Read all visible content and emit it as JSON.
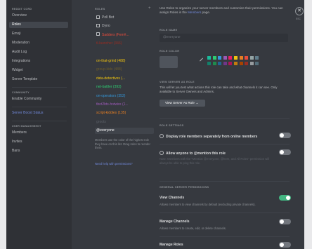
{
  "sidebar": {
    "server_header": "REDDIT CORD",
    "items": [
      "Overview",
      "Roles",
      "Emoji",
      "Moderation",
      "Audit Log",
      "Integrations",
      "Widget",
      "Server Template"
    ],
    "community_header": "COMMUNITY",
    "community_items": [
      "Enable Community"
    ],
    "boost_item": "Server Boost Status",
    "user_mgmt_header": "USER MANAGEMENT",
    "user_items": [
      "Members",
      "Invites",
      "Bans"
    ]
  },
  "roles_panel": {
    "header": "ROLES",
    "items": [
      {
        "name": "Poll Bot",
        "color": "#b9bbbe",
        "locked": true
      },
      {
        "name": "Dyno",
        "color": "#b9bbbe",
        "locked": true
      },
      {
        "name": "Sadders (Fem#...",
        "color": "#e74c3c",
        "locked": true
      },
      {
        "name": "tl-launcher (346)",
        "color": "#992d22",
        "locked": false
      },
      {
        "name": "",
        "color": "#8e3b6b",
        "locked": false
      },
      {
        "name": "on-that-grind (488)",
        "color": "#f1c40f",
        "locked": false
      },
      {
        "name": "group-kids (488)",
        "color": "#6b5a2b",
        "locked": false
      },
      {
        "name": "data-detectives (...",
        "color": "#f1c40f",
        "locked": false
      },
      {
        "name": "net-battler (393)",
        "color": "#2ecc71",
        "locked": false
      },
      {
        "name": "on-operators (352)",
        "color": "#3498db",
        "locked": false
      },
      {
        "name": "tbot2bts-hotwire (1...",
        "color": "#9b59b6",
        "locked": false
      },
      {
        "name": "script-kiddies (135)",
        "color": "#e67e22",
        "locked": false
      },
      {
        "name": "groots",
        "color": "#5c6068",
        "locked": false
      },
      {
        "name": "@everyone",
        "color": "#ffffff",
        "locked": false
      }
    ],
    "info": "Members use the color of the highest role they have on this list. Drag roles to reorder them.",
    "help_link": "Need help with permissions?"
  },
  "main": {
    "intro_text": "Use Roles to organize your server members and customize their permissions. You can assign Roles in the ",
    "intro_link": "Members",
    "intro_end": " page.",
    "role_name_label": "ROLE NAME",
    "role_name_value": "@everyone",
    "role_color_label": "ROLE COLOR",
    "colors": {
      "default": "#4f545c",
      "swatches": [
        "#1abc9c",
        "#2ecc71",
        "#3498db",
        "#9b59b6",
        "#e91e63",
        "#f1c40f",
        "#e67e22",
        "#e74c3c",
        "#95a5a6",
        "#607d8b",
        "#11806a",
        "#1f8b4c",
        "#206694",
        "#71368a",
        "#ad1457",
        "#c27c0e",
        "#a84300",
        "#992d22",
        "#979c9f",
        "#546e7a"
      ]
    },
    "view_as_label": "VIEW SERVER AS ROLE",
    "view_as_desc": "This will let you test what actions this role can take and what channels it can see. Only available to Server Owners and Admins.",
    "view_as_button": "View Server As Role →",
    "settings_label": "ROLE SETTINGS",
    "display_separately": "Display role members separately from online members",
    "allow_mention": "Allow anyone to @mention this role",
    "allow_mention_desc": "Note: Members with the \"Mention @everyone, @here, and All Roles\" permission will always be able to ping this role.",
    "permissions_label": "GENERAL SERVER PERMISSIONS",
    "permissions": [
      {
        "title": "View Channels",
        "desc": "Allows members to view channels by default (excluding private channels).",
        "on": true
      },
      {
        "title": "Manage Channels",
        "desc": "Allows members to create, edit, or delete channels.",
        "on": false
      },
      {
        "title": "Manage Roles",
        "desc": "",
        "on": false
      }
    ],
    "close_label": "✕",
    "esc_label": "ESC"
  }
}
